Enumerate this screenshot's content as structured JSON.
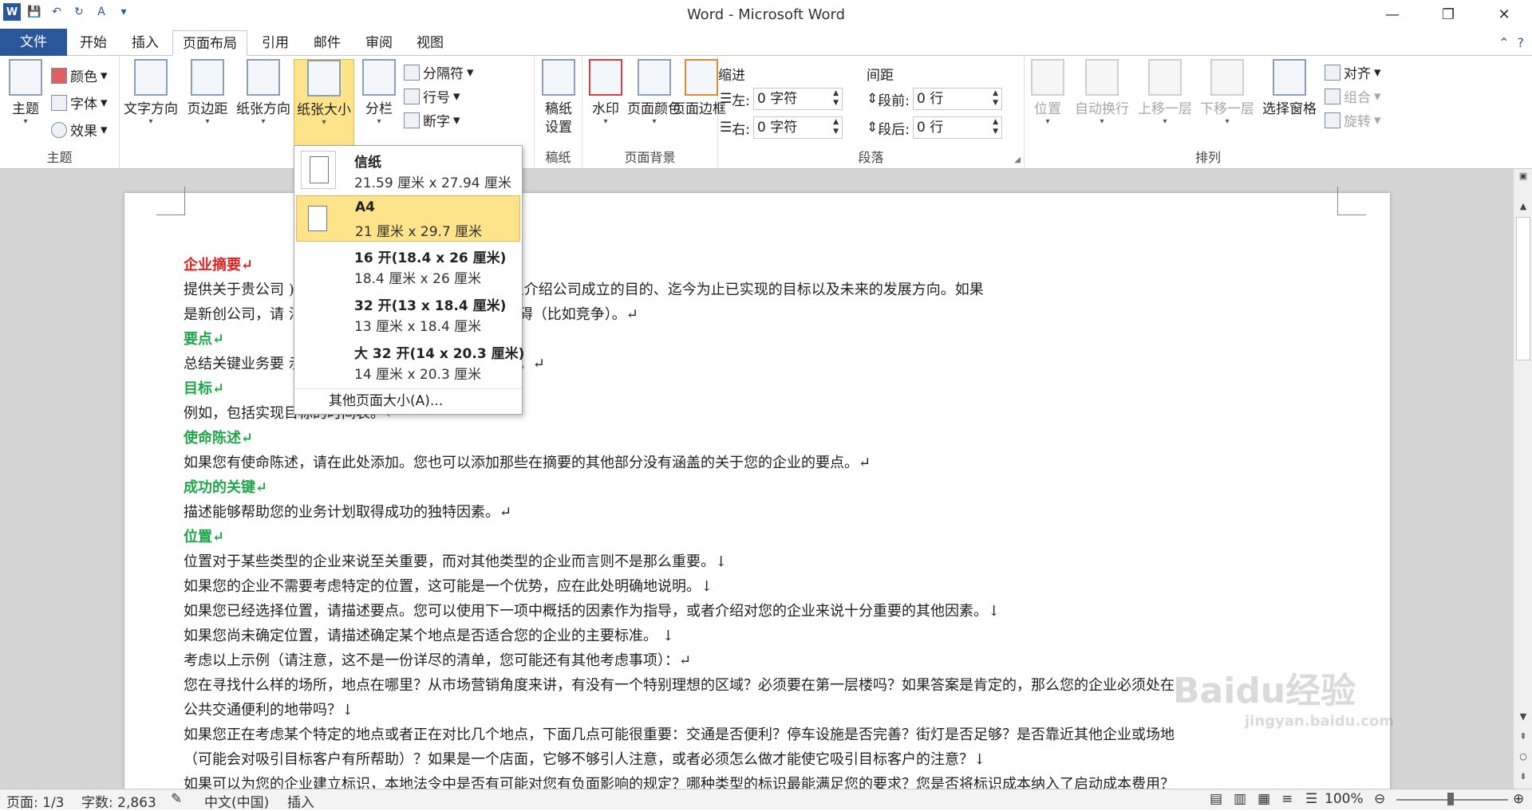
{
  "window": {
    "title": "Word - Microsoft Word",
    "controls": [
      "—",
      "❐",
      "✕"
    ]
  },
  "tabs": [
    "文件",
    "开始",
    "插入",
    "页面布局",
    "引用",
    "邮件",
    "审阅",
    "视图"
  ],
  "active_tab": "页面布局",
  "ribbon": {
    "theme_group": {
      "label": "主题",
      "theme": "主题",
      "colors": "颜色",
      "fonts": "字体",
      "effects": "效果"
    },
    "page_setup_group": {
      "label": "页面设置",
      "text_direction": "文字方向",
      "margins": "页边距",
      "orientation": "纸张方向",
      "size": "纸张大小",
      "columns": "分栏",
      "breaks": "分隔符",
      "line_numbers": "行号",
      "hyphenation": "断字"
    },
    "draft_group": {
      "label": "稿纸",
      "draft_setting_1": "稿纸",
      "draft_setting_2": "设置"
    },
    "background_group": {
      "label": "页面背景",
      "watermark": "水印",
      "page_color": "页面颜色",
      "page_borders": "页面边框"
    },
    "paragraph_group": {
      "label": "段落",
      "indent": "缩进",
      "spacing": "间距",
      "left": "左:",
      "right": "右:",
      "before": "段前:",
      "after": "段后:",
      "left_val": "0 字符",
      "right_val": "0 字符",
      "before_val": "0 行",
      "after_val": "0 行"
    },
    "arrange_group": {
      "label": "排列",
      "position": "位置",
      "wrap": "自动换行",
      "forward": "上移一层",
      "backward": "下移一层",
      "pane": "选择窗格",
      "align": "对齐",
      "group": "组合",
      "rotate": "旋转"
    }
  },
  "paper_menu": {
    "items": [
      {
        "name": "信纸",
        "size": "21.59 厘米 x 27.94 厘米"
      },
      {
        "name": "A4",
        "size": "21 厘米 x 29.7 厘米"
      },
      {
        "name": "16 开(18.4 x 26 厘米)",
        "size": "18.4 厘米 x 26 厘米"
      },
      {
        "name": "32 开(13 x 18.4 厘米)",
        "size": "13 厘米 x 18.4 厘米"
      },
      {
        "name": "大 32 开(14 x 20.3 厘米)",
        "size": "14 厘米 x 20.3 厘米"
      }
    ],
    "selected": "A4",
    "more": "其他页面大小(A)..."
  },
  "document": {
    "lines": [
      {
        "cls": "h-red",
        "text": "企业摘要↵"
      },
      {
        "cls": "",
        "text": "提供关于贵公司                                          )。例如，如果贵公司已成立，您可以介绍公司成立的目的、迄今为止已实现的目标以及未来的发展方向。如果"
      },
      {
        "cls": "",
        "text": "是新创公司，请                                          法和时间以及您将如何克服主要的障碍（比如竞争）。↵"
      },
      {
        "cls": "h-green",
        "text": "要点↵"
      },
      {
        "cls": "",
        "text": "总结关键业务要                                          示几年时间内的销售额、成本和利润。↵"
      },
      {
        "cls": "h-green",
        "text": "目标↵"
      },
      {
        "cls": "",
        "text": "例如，包括实现目标的时间表。↵"
      },
      {
        "cls": "h-green",
        "text": "使命陈述↵"
      },
      {
        "cls": "",
        "text": "如果您有使命陈述，请在此处添加。您也可以添加那些在摘要的其他部分没有涵盖的关于您的企业的要点。↵"
      },
      {
        "cls": "h-green",
        "text": "成功的关键↵"
      },
      {
        "cls": "",
        "text": "描述能够帮助您的业务计划取得成功的独特因素。↵"
      },
      {
        "cls": "h-green",
        "text": "位置↵"
      },
      {
        "cls": "",
        "text": "位置对于某些类型的企业来说至关重要，而对其他类型的企业而言则不是那么重要。↓"
      },
      {
        "cls": "",
        "text": "如果您的企业不需要考虑特定的位置，这可能是一个优势，应在此处明确地说明。↓"
      },
      {
        "cls": "",
        "text": "如果您已经选择位置，请描述要点。您可以使用下一项中概括的因素作为指导，或者介绍对您的企业来说十分重要的其他因素。↓"
      },
      {
        "cls": "",
        "text": "如果您尚未确定位置，请描述确定某个地点是否适合您的企业的主要标准。  ↓"
      },
      {
        "cls": "",
        "text": "考虑以上示例（请注意，这不是一份详尽的清单，您可能还有其他考虑事项）：↵"
      },
      {
        "cls": "",
        "text": "您在寻找什么样的场所，地点在哪里？从市场营销角度来讲，有没有一个特别理想的区域？必须要在第一层楼吗？如果答案是肯定的，那么您的企业必须处在"
      },
      {
        "cls": "",
        "text": "公共交通便利的地带吗？↓"
      },
      {
        "cls": "",
        "text": "如果您正在考虑某个特定的地点或者正在对比几个地点，下面几点可能很重要：交通是否便利？停车设施是否完善？街灯是否足够？是否靠近其他企业或场地"
      },
      {
        "cls": "",
        "text": "（可能会对吸引目标客户有所帮助）？如果是一个店面，它够不够引人注意，或者必须怎么做才能使它吸引目标客户的注意？↓"
      },
      {
        "cls": "",
        "text": "如果可以为您的企业建立标识，本地法令中是否有可能对您有负面影响的规定？哪种类型的标识最能满足您的要求？您是否将标识成本纳入了启动成本费用？"
      }
    ]
  },
  "status": {
    "page": "页面: 1/3",
    "words": "字数: 2,863",
    "lang": "中文(中国)",
    "mode": "插入",
    "zoom": "100%"
  },
  "watermark": {
    "main": "Baidu经验",
    "sub": "jingyan.baidu.com"
  }
}
